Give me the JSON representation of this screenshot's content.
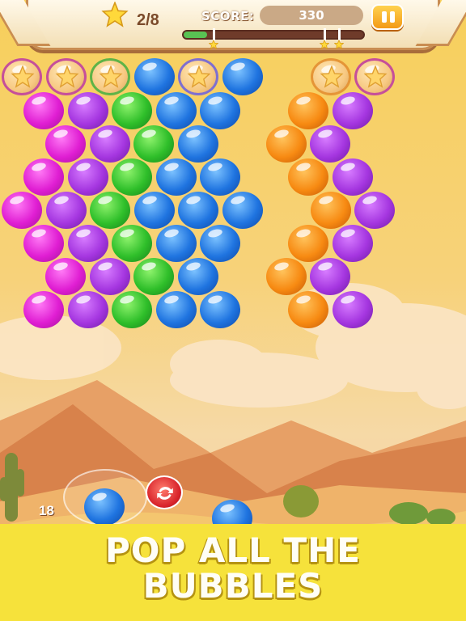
{
  "hud": {
    "stars_collected": "2/8",
    "score_label": "SCORE:",
    "score_value": "330",
    "progress": 0.13,
    "star_thresholds": [
      0.16,
      0.78,
      0.86
    ],
    "star_icon": "star-icon",
    "pause_icon": "pause-icon"
  },
  "board": {
    "rows": [
      [
        "star-magenta",
        "star-purple",
        "star-green",
        "blue",
        "star-blue",
        "blue",
        null,
        "star-orange",
        "star-purple"
      ],
      [
        "magenta",
        "purple",
        "green",
        "blue",
        "blue",
        null,
        "orange",
        "purple"
      ],
      [
        "magenta",
        "purple",
        "green",
        "blue",
        null,
        "orange",
        "purple"
      ],
      [
        "magenta",
        "purple",
        "green",
        "blue",
        "blue",
        null,
        "orange",
        "purple"
      ],
      [
        "magenta",
        "purple",
        "green",
        "blue",
        "blue",
        "blue",
        null,
        "orange",
        "purple"
      ],
      [
        "magenta",
        "purple",
        "green",
        "blue",
        "blue",
        null,
        "orange",
        "purple"
      ],
      [
        "magenta",
        "purple",
        "green",
        "blue",
        null,
        "orange",
        "purple"
      ],
      [
        "magenta",
        "purple",
        "green",
        "blue",
        "blue",
        null,
        "orange",
        "purple"
      ]
    ]
  },
  "shooter": {
    "shots_left": "18",
    "current_bubble": "blue",
    "next_bubble": "blue",
    "swap_icon": "swap-icon"
  },
  "banner": {
    "line1": "POP ALL THE",
    "line2": "BUBBLES"
  },
  "colors": {
    "magenta": "#e01ed3",
    "purple": "#a536e0",
    "green": "#2fbf2a",
    "blue": "#1f74e0",
    "orange": "#f78a12",
    "banner": "#f6e23b"
  }
}
